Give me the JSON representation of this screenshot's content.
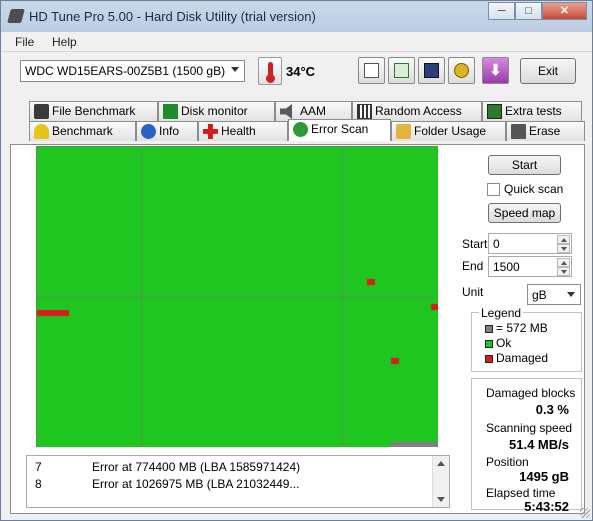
{
  "window": {
    "title": "HD Tune Pro 5.00 - Hard Disk Utility (trial version)",
    "controls": {
      "minimize": "─",
      "maximize": "□",
      "close": "✕"
    }
  },
  "menu": {
    "file": "File",
    "help": "Help"
  },
  "toolbar": {
    "drive": "WDC WD15EARS-00Z5B1 (1500 gB)",
    "temperature": "34°C",
    "exit_label": "Exit",
    "icons": [
      "copy-text-icon",
      "copy-screenshot-icon",
      "save-icon",
      "options-icon",
      "download-icon"
    ]
  },
  "tabs_top": [
    {
      "label": "File Benchmark",
      "icon": "file-benchmark-icon"
    },
    {
      "label": "Disk monitor",
      "icon": "disk-monitor-icon"
    },
    {
      "label": "AAM",
      "icon": "speaker-icon"
    },
    {
      "label": "Random Access",
      "icon": "random-access-icon"
    },
    {
      "label": "Extra tests",
      "icon": "extra-tests-icon"
    }
  ],
  "tabs_bottom": [
    {
      "label": "Benchmark",
      "icon": "benchmark-icon"
    },
    {
      "label": "Info",
      "icon": "info-icon"
    },
    {
      "label": "Health",
      "icon": "health-icon"
    },
    {
      "label": "Error Scan",
      "icon": "error-scan-icon",
      "active": true
    },
    {
      "label": "Folder Usage",
      "icon": "folder-icon"
    },
    {
      "label": "Erase",
      "icon": "erase-icon"
    }
  ],
  "scan": {
    "start_button": "Start",
    "quick_scan_label": "Quick scan",
    "quick_scan_checked": false,
    "speed_map_button": "Speed map",
    "start_label": "Start",
    "start_value": "0",
    "end_label": "End",
    "end_value": "1500",
    "unit_label": "Unit",
    "unit_value": "gB"
  },
  "legend": {
    "title": "Legend",
    "block_size": "= 572 MB",
    "ok": "Ok",
    "damaged": "Damaged",
    "colors": {
      "block": "#808080",
      "ok": "#1fc61f",
      "damaged": "#d91c1c"
    }
  },
  "stats": {
    "damaged_blocks_label": "Damaged blocks",
    "damaged_blocks_value": "0.3 %",
    "scanning_speed_label": "Scanning speed",
    "scanning_speed_value": "51.4 MB/s",
    "position_label": "Position",
    "position_value": "1495 gB",
    "elapsed_label": "Elapsed time",
    "elapsed_value": "5:43:52"
  },
  "grid": {
    "columns": 50,
    "rows": 50,
    "unscanned_cells": 6,
    "damaged_cells": [
      [
        41,
        22
      ],
      [
        0,
        27
      ],
      [
        1,
        27
      ],
      [
        2,
        27
      ],
      [
        3,
        27
      ],
      [
        49,
        26
      ],
      [
        44,
        35
      ]
    ]
  },
  "errors": [
    {
      "n": "7",
      "text": "Error at 774400 MB (LBA 1585971424)"
    },
    {
      "n": "8",
      "text": "Error at 1026975 MB (LBA 21032449..."
    }
  ]
}
